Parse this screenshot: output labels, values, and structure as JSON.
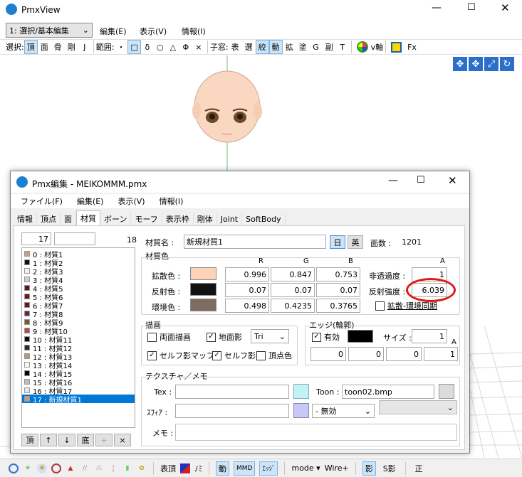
{
  "main": {
    "title": "PmxView",
    "mode_select": "1: 選択/基本編集",
    "menu": [
      "編集(E)",
      "表示(V)",
      "情報(I)"
    ],
    "tb_select_label": "選択:",
    "tb_select": [
      {
        "t": "頂",
        "on": true
      },
      {
        "t": "面",
        "on": false
      },
      {
        "t": "骨",
        "on": false
      },
      {
        "t": "剛",
        "on": false
      },
      {
        "t": "J",
        "on": false
      }
    ],
    "tb_range_label": "範囲:",
    "tb_range": [
      {
        "t": "・",
        "on": false
      },
      {
        "t": "□",
        "on": true
      },
      {
        "t": "δ",
        "on": false
      },
      {
        "t": "○",
        "on": false
      },
      {
        "t": "△",
        "on": false
      },
      {
        "t": "Φ",
        "on": false
      },
      {
        "t": "×",
        "on": false
      }
    ],
    "tb_sub_label": "子窓:",
    "tb_sub": [
      {
        "t": "表",
        "on": false
      },
      {
        "t": "選",
        "on": false
      },
      {
        "t": "絞",
        "on": true
      },
      {
        "t": "動",
        "on": true
      },
      {
        "t": "拡",
        "on": false
      },
      {
        "t": "塗",
        "on": false
      },
      {
        "t": "G",
        "on": false
      },
      {
        "t": "副",
        "on": false
      },
      {
        "t": "T",
        "on": false
      }
    ],
    "tb_axis": "v軸",
    "tb_fx": "Fx",
    "bottom": {
      "hyocho": "表頂",
      "no": "ﾉﾐ",
      "dou": "動",
      "mmd": "MMD",
      "edge": "ｴｯｼﾞ",
      "mode": "mode",
      "wire": "Wire+",
      "shadow": "影",
      "sshadow": "S影",
      "sei": "正"
    }
  },
  "editor": {
    "title": "Pmx編集 - MEIKOMMM.pmx",
    "menu": [
      "ファイル(F)",
      "編集(E)",
      "表示(V)",
      "情報(I)"
    ],
    "tabs": [
      "情報",
      "頂点",
      "面",
      "材質",
      "ボーン",
      "モーフ",
      "表示枠",
      "剛体",
      "Joint",
      "SoftBody"
    ],
    "active_tab": 3,
    "list_index": "17",
    "list_count": "18",
    "materials": [
      {
        "label": "0 : 材質1",
        "color": "#c8a08c"
      },
      {
        "label": "1 : 材質2",
        "color": "#111111"
      },
      {
        "label": "2 : 材質3",
        "color": "#f2f2f2"
      },
      {
        "label": "3 : 材質4",
        "color": "#cfcfcf"
      },
      {
        "label": "4 : 材質5",
        "color": "#6a0f0f"
      },
      {
        "label": "5 : 材質6",
        "color": "#7a1414"
      },
      {
        "label": "6 : 材質7",
        "color": "#6a1818"
      },
      {
        "label": "7 : 材質8",
        "color": "#55303f"
      },
      {
        "label": "8 : 材質9",
        "color": "#7a5a2a"
      },
      {
        "label": "9 : 材質10",
        "color": "#b84848"
      },
      {
        "label": "10 : 材質11",
        "color": "#0a0a0a"
      },
      {
        "label": "11 : 材質12",
        "color": "#3a2418"
      },
      {
        "label": "12 : 材質13",
        "color": "#b39a7a"
      },
      {
        "label": "13 : 材質14",
        "color": "#f8f8f8"
      },
      {
        "label": "14 : 材質15",
        "color": "#050505"
      },
      {
        "label": "15 : 材質16",
        "color": "#bdbdbd"
      },
      {
        "label": "16 : 材質17",
        "color": "#e6e6e6"
      },
      {
        "label": "17 : 新規材質1",
        "color": "#c09a86"
      }
    ],
    "list_buttons": [
      "頂",
      "↑",
      "↓",
      "底",
      "+",
      "×"
    ],
    "mat_name_label": "材質名 :",
    "mat_name": "新規材質1",
    "btn_jp": "日",
    "btn_en": "英",
    "faces_label": "面数 :",
    "faces": "1201",
    "color_group": "材質色",
    "col_r": "R",
    "col_g": "G",
    "col_b": "B",
    "col_a": "A",
    "diffuse_label": "拡散色 :",
    "diffuse_color": "#fdd3b8",
    "diffuse": [
      "0.996",
      "0.847",
      "0.753"
    ],
    "specular_label": "反射色 :",
    "specular_color": "#121212",
    "specular": [
      "0.07",
      "0.07",
      "0.07"
    ],
    "ambient_label": "環境色 :",
    "ambient_color": "#7f6c60",
    "ambient": [
      "0.498",
      "0.4235",
      "0.3765"
    ],
    "alpha_label": "非透過度 :",
    "alpha": "1",
    "spec_power_label": "反射強度 :",
    "spec_power": "6.039",
    "sync_label": "拡散-環境同期",
    "draw_group": "描画",
    "both_sides": "両面描画",
    "ground_shadow": "地面影",
    "tri": "Tri",
    "self_map": "セルフ影マップ",
    "self_shadow": "セルフ影",
    "vertex_color": "頂点色",
    "edge_group": "エッジ(輪郭)",
    "edge_enabled": "有効",
    "edge_size_label": "サイズ :",
    "edge_size": "1",
    "edge_color": "#000000",
    "edge_rgba": [
      "0",
      "0",
      "0",
      "1"
    ],
    "edge_a": "A",
    "tex_group": "テクスチャ／メモ",
    "tex_label": "Tex :",
    "tex": "",
    "toon_label": "Toon :",
    "toon": "toon02.bmp",
    "sphere_label": "ｽﾌｨｱ :",
    "sphere": "",
    "sphere_mode": "- 無効",
    "memo_label": "メモ :",
    "memo": ""
  }
}
